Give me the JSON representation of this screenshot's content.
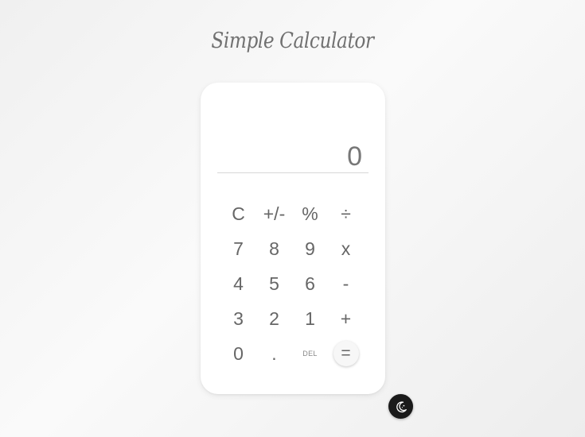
{
  "app": {
    "title": "Simple Calculator"
  },
  "display": {
    "history": "",
    "value": "0"
  },
  "keys": [
    {
      "label": "C",
      "name": "clear-button"
    },
    {
      "label": "+/-",
      "name": "negate-button"
    },
    {
      "label": "%",
      "name": "percent-button"
    },
    {
      "label": "÷",
      "name": "divide-button"
    },
    {
      "label": "7",
      "name": "digit-7-button"
    },
    {
      "label": "8",
      "name": "digit-8-button"
    },
    {
      "label": "9",
      "name": "digit-9-button"
    },
    {
      "label": "x",
      "name": "multiply-button"
    },
    {
      "label": "4",
      "name": "digit-4-button"
    },
    {
      "label": "5",
      "name": "digit-5-button"
    },
    {
      "label": "6",
      "name": "digit-6-button"
    },
    {
      "label": "-",
      "name": "subtract-button"
    },
    {
      "label": "3",
      "name": "digit-3-button"
    },
    {
      "label": "2",
      "name": "digit-2-button"
    },
    {
      "label": "1",
      "name": "digit-1-button"
    },
    {
      "label": "+",
      "name": "add-button"
    },
    {
      "label": "0",
      "name": "digit-0-button"
    },
    {
      "label": ".",
      "name": "decimal-button"
    },
    {
      "label": "DEL",
      "name": "delete-button"
    },
    {
      "label": "=",
      "name": "equals-button"
    }
  ],
  "theme_toggle": {
    "icon": "moon-icon",
    "background": "#1a1a1a",
    "icon_color": "#ffffff"
  },
  "colors": {
    "card": "#ffffff",
    "text": "#666666",
    "title": "#707070"
  }
}
